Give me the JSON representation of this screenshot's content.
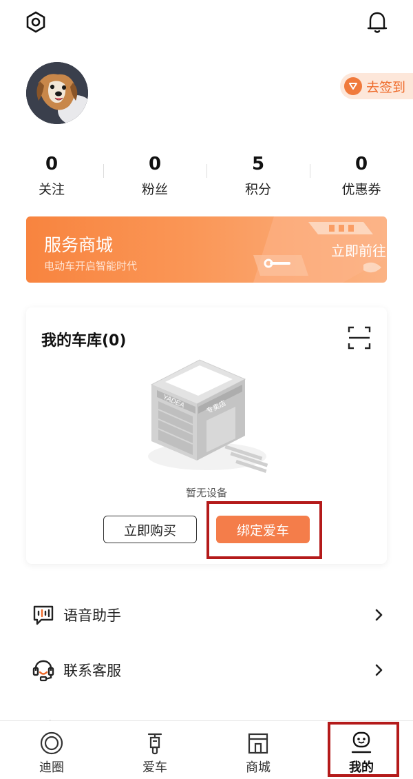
{
  "header": {
    "settings_icon": "hexagon-settings-icon",
    "bell_icon": "bell-icon"
  },
  "profile": {
    "avatar": "dog-avatar",
    "checkin_label": "去签到"
  },
  "stats": [
    {
      "value": "0",
      "label": "关注"
    },
    {
      "value": "0",
      "label": "粉丝"
    },
    {
      "value": "5",
      "label": "积分"
    },
    {
      "value": "0",
      "label": "优惠券"
    }
  ],
  "banner": {
    "title": "服务商城",
    "subtitle": "电动车开启智能时代",
    "action": "立即前往"
  },
  "garage": {
    "title": "我的车库(0)",
    "store_sign_brand": "YADEA",
    "store_sign_text": "专卖店",
    "empty_text": "暂无设备",
    "buy_label": "立即购买",
    "bind_label": "绑定爱车"
  },
  "menu": [
    {
      "label": "语音助手",
      "icon": "voice-assistant-icon"
    },
    {
      "label": "联系客服",
      "icon": "customer-service-icon"
    }
  ],
  "tabs": [
    {
      "label": "迪圈",
      "icon": "circle-icon"
    },
    {
      "label": "爱车",
      "icon": "scooter-icon"
    },
    {
      "label": "商城",
      "icon": "store-icon"
    },
    {
      "label": "我的",
      "icon": "profile-icon",
      "active": true
    }
  ],
  "colors": {
    "accent": "#f47d4a",
    "highlight_box": "#b41a1a",
    "banner_start": "#f8843f"
  }
}
